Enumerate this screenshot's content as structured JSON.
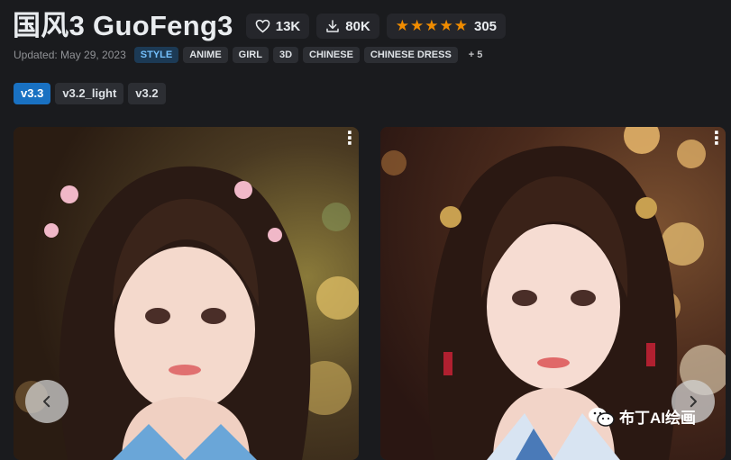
{
  "header": {
    "title": "国风3 GuoFeng3",
    "likes": "13K",
    "downloads": "80K",
    "rating_stars": "★★★★★",
    "rating_count": "305"
  },
  "meta": {
    "updated": "Updated: May 29, 2023",
    "tags": [
      "STYLE",
      "ANIME",
      "GIRL",
      "3D",
      "CHINESE",
      "CHINESE DRESS"
    ],
    "more_tags": "+ 5"
  },
  "versions": [
    {
      "label": "v3.3",
      "active": true
    },
    {
      "label": "v3.2_light",
      "active": false
    },
    {
      "label": "v3.2",
      "active": false
    }
  ],
  "gallery": {
    "menu_glyph": "⋮",
    "prev_icon": "chevron-left-icon",
    "next_icon": "chevron-right-icon"
  },
  "watermark": {
    "text": "布丁AI绘画",
    "icon": "wechat-icon"
  },
  "colors": {
    "background": "#1a1b1e",
    "accent": "#1971c2",
    "star": "#f08c00",
    "style_tag_text": "#74c0fc"
  }
}
